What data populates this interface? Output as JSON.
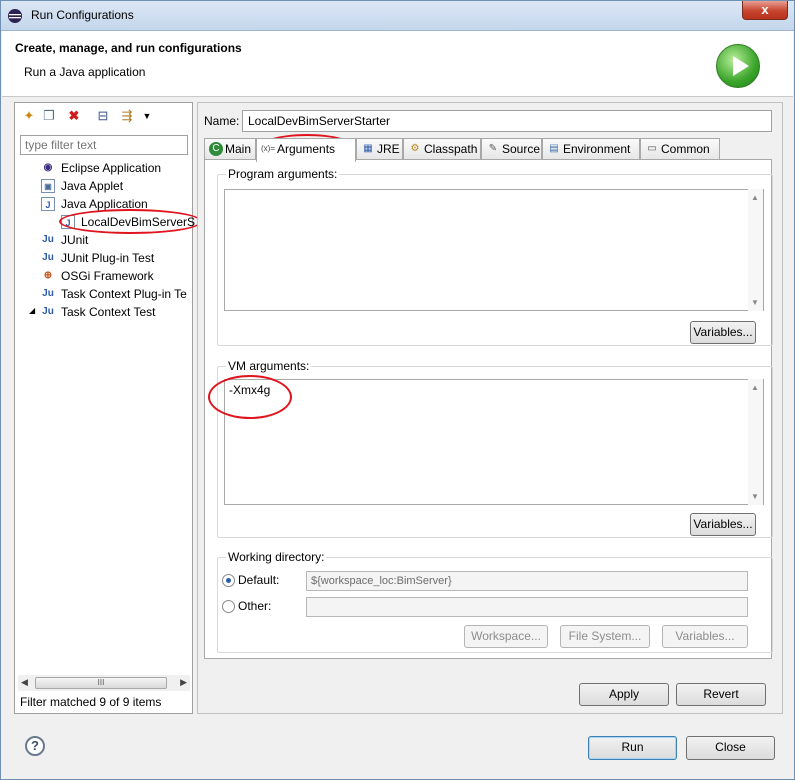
{
  "window": {
    "title": "Run Configurations",
    "close_label": "x"
  },
  "header": {
    "title": "Create, manage, and run configurations",
    "subtitle": "Run a Java application"
  },
  "left": {
    "filter_placeholder": "type filter text",
    "tree": [
      {
        "label": "Eclipse Application"
      },
      {
        "label": "Java Applet"
      },
      {
        "label": "Java Application"
      },
      {
        "label": "LocalDevBimServerS"
      },
      {
        "label": "JUnit"
      },
      {
        "label": "JUnit Plug-in Test"
      },
      {
        "label": "OSGi Framework"
      },
      {
        "label": "Task Context Plug-in Te"
      },
      {
        "label": "Task Context Test"
      }
    ],
    "scroll_thumb": "III",
    "status": "Filter matched 9 of 9 items"
  },
  "right": {
    "name_label": "Name:",
    "name_value": "LocalDevBimServerStarter",
    "tabs": [
      {
        "label": "Main"
      },
      {
        "label": "Arguments"
      },
      {
        "label": "JRE"
      },
      {
        "label": "Classpath"
      },
      {
        "label": "Source"
      },
      {
        "label": "Environment"
      },
      {
        "label": "Common"
      }
    ],
    "program_args_label": "Program arguments:",
    "program_args_value": "",
    "variables_label": "Variables...",
    "vm_args_label": "VM arguments:",
    "vm_args_value": "-Xmx4g",
    "working_dir": {
      "label": "Working directory:",
      "default_label": "Default:",
      "default_value": "${workspace_loc:BimServer}",
      "other_label": "Other:",
      "other_value": "",
      "workspace_btn": "Workspace...",
      "filesystem_btn": "File System...",
      "variables_btn": "Variables..."
    },
    "apply_label": "Apply",
    "revert_label": "Revert"
  },
  "footer": {
    "help_label": "?",
    "run_label": "Run",
    "close_label": "Close"
  }
}
